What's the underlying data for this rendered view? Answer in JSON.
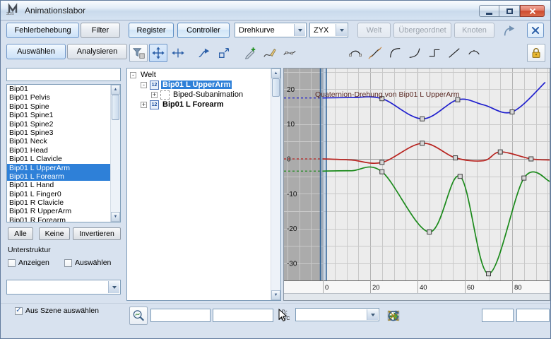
{
  "window": {
    "title": "Animationslabor"
  },
  "toolbar1": {
    "tabs": [
      {
        "label": "Fehlerbehebung",
        "active": true
      },
      {
        "label": "Filter",
        "active": false
      }
    ],
    "register_label": "Register",
    "controller_label": "Controller",
    "curve_combo_value": "Drehkurve",
    "order_combo_value": "ZYX",
    "disabled_buttons": [
      "Welt",
      "Übergeordnet",
      "Knoten"
    ]
  },
  "toolbar2": {
    "tabs": [
      {
        "label": "Auswählen",
        "active": true
      },
      {
        "label": "Analysieren",
        "active": false
      }
    ],
    "left_tools": [
      {
        "icon": "funnel",
        "name": "filter-keys-button",
        "style": "raised"
      },
      {
        "icon": "move4",
        "name": "move-keys-button",
        "style": "active"
      },
      {
        "icon": "moveh",
        "name": "move-horizontal-button"
      },
      {
        "sep": true
      },
      {
        "icon": "slide",
        "name": "slide-keys-button"
      },
      {
        "icon": "scale",
        "name": "scale-keys-button"
      },
      {
        "sep": true
      },
      {
        "icon": "addkey",
        "name": "add-keys-button"
      },
      {
        "icon": "drawcurve",
        "name": "draw-curves-button"
      },
      {
        "icon": "reducekey",
        "name": "reduce-keys-button"
      }
    ],
    "right_tools": [
      {
        "icon": "tflat",
        "name": "set-tangents-flat-button"
      },
      {
        "icon": "tspline",
        "name": "set-tangents-custom-button"
      },
      {
        "icon": "tfast",
        "name": "set-tangents-fast-button"
      },
      {
        "icon": "tslow",
        "name": "set-tangents-slow-button"
      },
      {
        "icon": "tstep",
        "name": "set-tangents-step-button"
      },
      {
        "icon": "tlinear",
        "name": "set-tangents-linear-button"
      },
      {
        "icon": "tsmooth",
        "name": "set-tangents-smooth-button"
      }
    ],
    "lock_tool": {
      "icon": "lock",
      "name": "lock-tangents-button"
    }
  },
  "left_panel": {
    "filter_value": "",
    "items": [
      "Bip01",
      "Bip01 Pelvis",
      "Bip01 Spine",
      "Bip01 Spine1",
      "Bip01 Spine2",
      "Bip01 Spine3",
      "Bip01 Neck",
      "Bip01 Head",
      "Bip01 L Clavicle",
      "Bip01 L UpperArm",
      "Bip01 L Forearm",
      "Bip01 L Hand",
      "Bip01 L Finger0",
      "Bip01 R Clavicle",
      "Bip01 R UpperArm",
      "Bip01 R Forearm"
    ],
    "selected_indices": [
      9,
      10
    ],
    "buttons": [
      "Alle",
      "Keine",
      "Invertieren"
    ],
    "substructure_label": "Unterstruktur",
    "checkboxes": [
      {
        "label": "Anzeigen",
        "checked": false
      },
      {
        "label": "Auswählen",
        "checked": false
      }
    ],
    "preset_combo_value": "",
    "scene_checkbox": {
      "label": "Aus Szene auswählen",
      "checked": true
    }
  },
  "tree": {
    "items": [
      {
        "label": "Welt",
        "level": 0,
        "expander": "minus",
        "icon": null,
        "selected": false,
        "bold": false
      },
      {
        "label": "Bip01 L UpperArm",
        "level": 1,
        "expander": "minus",
        "icon": "xyz",
        "selected": true,
        "bold": true
      },
      {
        "label": "Biped-Subanimation",
        "level": 2,
        "expander": "plus",
        "icon": "sub",
        "selected": false,
        "bold": false
      },
      {
        "label": "Bip01 L Forearm",
        "level": 1,
        "expander": "plus",
        "icon": "xyz",
        "selected": false,
        "bold": true
      }
    ]
  },
  "chart_data": {
    "type": "line",
    "title": "Quaternion-Drehung von Bip01 L UpperArm",
    "x_ticks": [
      0,
      20,
      40,
      60,
      80
    ],
    "y_ticks": [
      20,
      10,
      0,
      -10,
      -20,
      -30
    ],
    "xlim": [
      -16.5,
      96.5
    ],
    "ylim": [
      -35,
      26
    ],
    "grid": true,
    "legend": "none",
    "current_time": 0,
    "series": [
      {
        "name": "Blau",
        "color": "#2020CE",
        "pre_value": 17.5,
        "points": [
          [
            0,
            17.5
          ],
          [
            12,
            17.6
          ],
          [
            25,
            17.3
          ],
          [
            42,
            11.5
          ],
          [
            57,
            17
          ],
          [
            68,
            15.5
          ],
          [
            80,
            13.5
          ],
          [
            94,
            22
          ]
        ],
        "markers": [
          [
            25,
            17.3
          ],
          [
            42,
            11.5
          ],
          [
            57,
            17
          ],
          [
            80,
            13.5
          ]
        ]
      },
      {
        "name": "Rot",
        "color": "#B82420",
        "pre_value": 0,
        "points": [
          [
            0,
            0
          ],
          [
            12,
            -0.3
          ],
          [
            25,
            -1
          ],
          [
            42,
            4.5
          ],
          [
            56,
            0.3
          ],
          [
            68,
            -0.5
          ],
          [
            75,
            2
          ],
          [
            88,
            0
          ],
          [
            96,
            -0.3
          ]
        ],
        "markers": [
          [
            25,
            -1
          ],
          [
            42,
            4.5
          ],
          [
            56,
            0.3
          ],
          [
            75,
            2
          ],
          [
            88,
            0
          ]
        ]
      },
      {
        "name": "Grün",
        "color": "#1B8A1B",
        "pre_value": -3.5,
        "points": [
          [
            0,
            -3.5
          ],
          [
            12,
            -3.4
          ],
          [
            25,
            -3.7
          ],
          [
            45,
            -21
          ],
          [
            58,
            -5
          ],
          [
            70,
            -33
          ],
          [
            85,
            -5.5
          ],
          [
            96,
            -6.5
          ]
        ],
        "markers": [
          [
            25,
            -3.7
          ],
          [
            45,
            -21
          ],
          [
            58,
            -5
          ],
          [
            70,
            -33
          ],
          [
            85,
            -5.5
          ]
        ]
      }
    ]
  },
  "bottom": {
    "abc_top": "[):",
    "abc_bottom": "ABC",
    "field_left_1": "",
    "field_left_2": "",
    "track_set_combo_value": "",
    "field_right_1": "",
    "field_right_2": "",
    "tools": [
      {
        "icon": "chartbox",
        "name": "curve-thumbnail-button"
      },
      {
        "icon": "greenrange",
        "name": "range-bar-button"
      },
      {
        "icon": "axescross",
        "name": "break-tangents-button"
      },
      {
        "icon": "recalc",
        "name": "update-view-button"
      }
    ]
  }
}
